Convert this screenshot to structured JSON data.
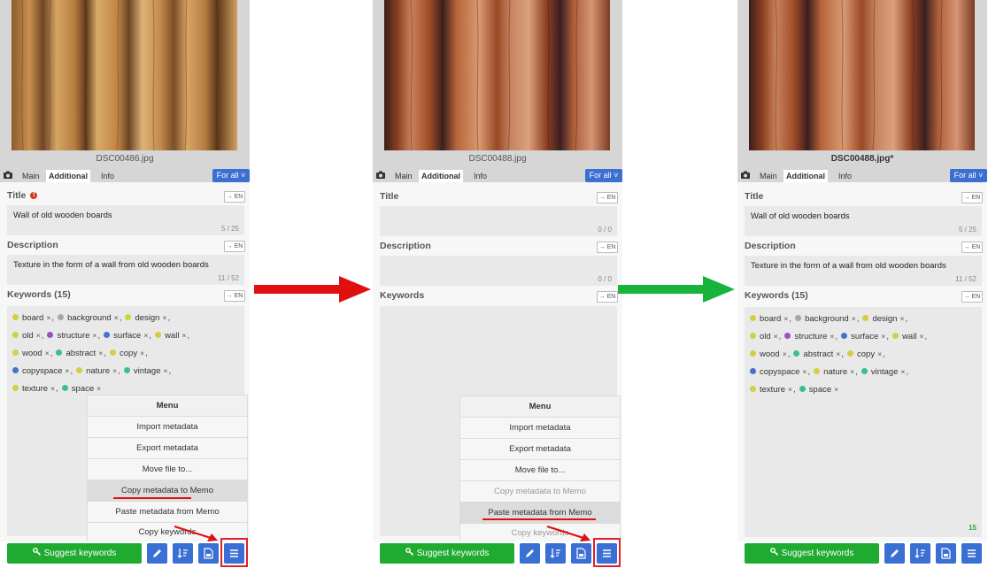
{
  "panels": [
    {
      "filename": "DSC00486.jpg",
      "filename_bold": false,
      "tabs": [
        "Main",
        "Additional",
        "Info"
      ],
      "forall": "For all ˅",
      "title_label": "Title",
      "title_required": "!",
      "title_value": "Wall of old wooden boards",
      "title_count": "5 / 25",
      "desc_label": "Description",
      "desc_value": "Texture in the form of a wall from old wooden boards",
      "desc_count": "11 / 52",
      "kw_label": "Keywords (15)",
      "en": "→ EN",
      "kw_count": "",
      "keyword_rows": [
        [
          {
            "t": "board",
            "c": "#d3cf45"
          },
          {
            "t": "background",
            "c": "#a6a6a6"
          },
          {
            "t": "design",
            "c": "#d3cf45"
          }
        ],
        [
          {
            "t": "old",
            "c": "#d3cf45"
          },
          {
            "t": "structure",
            "c": "#9a4fc4"
          },
          {
            "t": "surface",
            "c": "#4870cf"
          },
          {
            "t": "wall",
            "c": "#d3cf45"
          }
        ],
        [
          {
            "t": "wood",
            "c": "#d3cf45"
          },
          {
            "t": "abstract",
            "c": "#3dbf8a"
          },
          {
            "t": "copy",
            "c": "#d3cf45"
          }
        ],
        [
          {
            "t": "copyspace",
            "c": "#4870cf"
          },
          {
            "t": "nature",
            "c": "#d3cf45"
          },
          {
            "t": "vintage",
            "c": "#3dbf8a"
          }
        ],
        [
          {
            "t": "texture",
            "c": "#d3cf45"
          },
          {
            "t": "space",
            "c": "#3dbf8a"
          }
        ]
      ],
      "menu": [
        "Menu",
        "Import metadata",
        "Export metadata",
        "Move file to...",
        "Copy metadata to Memo",
        "Paste metadata from Memo",
        "Copy keywords"
      ],
      "suggest": "Suggest keywords"
    },
    {
      "filename": "DSC00488.jpg",
      "filename_bold": false,
      "tabs": [
        "Main",
        "Additional",
        "Info"
      ],
      "forall": "For all ˅",
      "title_label": "Title",
      "title_value": "",
      "title_count": "0 / 0",
      "desc_label": "Description",
      "desc_value": "",
      "desc_count": "0 / 0",
      "kw_label": "Keywords",
      "en": "→ EN",
      "kw_count": "",
      "keyword_rows": [],
      "menu": [
        "Menu",
        "Import metadata",
        "Export metadata",
        "Move file to...",
        "Copy metadata to Memo",
        "Paste metadata from Memo",
        "Copy keywords"
      ],
      "suggest": "Suggest keywords"
    },
    {
      "filename": "DSC00488.jpg*",
      "filename_bold": true,
      "tabs": [
        "Main",
        "Additional",
        "Info"
      ],
      "forall": "For all ˅",
      "title_label": "Title",
      "title_value": "Wall of old wooden boards",
      "title_count": "5 / 25",
      "desc_label": "Description",
      "desc_value": "Texture in the form of a wall from old wooden boards",
      "desc_count": "11 / 52",
      "kw_label": "Keywords (15)",
      "en": "→ EN",
      "kw_count": "15",
      "keyword_rows": [
        [
          {
            "t": "board",
            "c": "#d3cf45"
          },
          {
            "t": "background",
            "c": "#a6a6a6"
          },
          {
            "t": "design",
            "c": "#d3cf45"
          }
        ],
        [
          {
            "t": "old",
            "c": "#d3cf45"
          },
          {
            "t": "structure",
            "c": "#9a4fc4"
          },
          {
            "t": "surface",
            "c": "#4870cf"
          },
          {
            "t": "wall",
            "c": "#d3cf45"
          }
        ],
        [
          {
            "t": "wood",
            "c": "#d3cf45"
          },
          {
            "t": "abstract",
            "c": "#3dbf8a"
          },
          {
            "t": "copy",
            "c": "#d3cf45"
          }
        ],
        [
          {
            "t": "copyspace",
            "c": "#4870cf"
          },
          {
            "t": "nature",
            "c": "#d3cf45"
          },
          {
            "t": "vintage",
            "c": "#3dbf8a"
          }
        ],
        [
          {
            "t": "texture",
            "c": "#d3cf45"
          },
          {
            "t": "space",
            "c": "#3dbf8a"
          }
        ]
      ],
      "suggest": "Suggest keywords"
    }
  ],
  "colors": {
    "accent": "#3a6fd4",
    "suggest": "#1eab30",
    "arrow_red": "#e01010",
    "arrow_green": "#18b33a",
    "required": "#d93a1c"
  },
  "icons": [
    "camera-icon",
    "pencil-icon",
    "sort-icon",
    "save-file-icon",
    "menu-icon",
    "key-icon"
  ]
}
